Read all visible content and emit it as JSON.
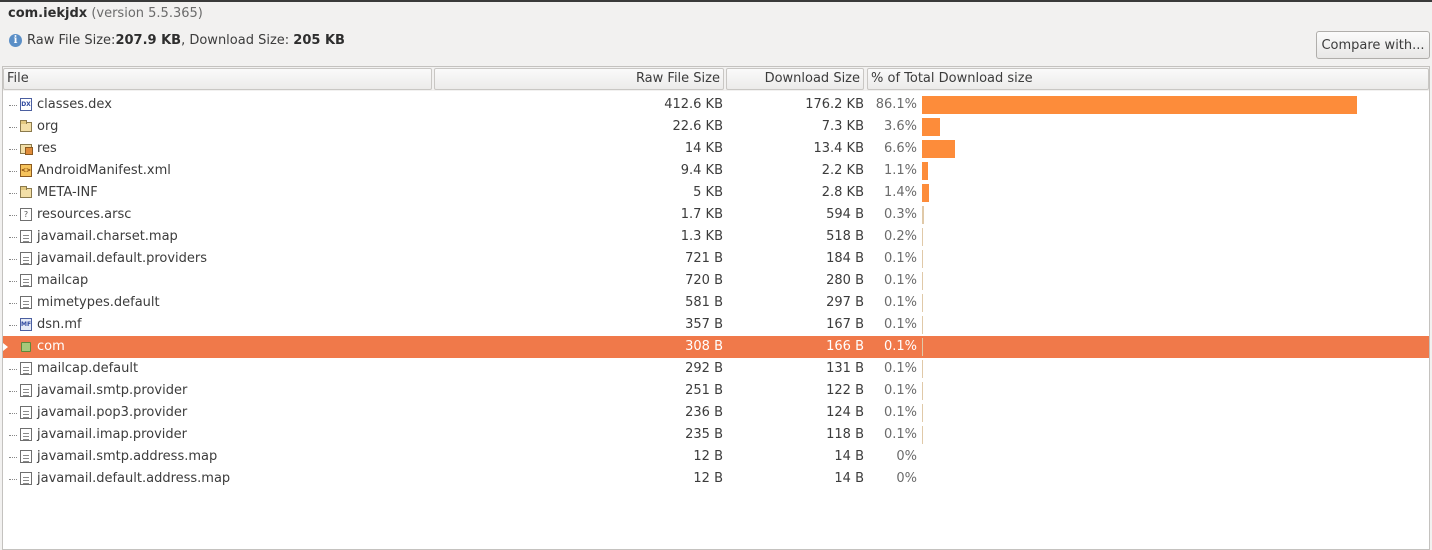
{
  "header": {
    "package": "com.iekjdx",
    "version": "(version 5.5.365)",
    "raw_label": "Raw File Size: ",
    "raw_value": "207.9 KB",
    "sep": ", Download Size: ",
    "dl_value": "205 KB",
    "compare_label": "Compare with..."
  },
  "columns": {
    "file": "File",
    "raw": "Raw File Size",
    "download": "Download Size",
    "percent": "% of Total Download size"
  },
  "rows": [
    {
      "name": "classes.dex",
      "icon": "dex-file-icon",
      "raw": "412.6 KB",
      "dl": "176.2 KB",
      "pct": "86.1%",
      "frac": 0.861
    },
    {
      "name": "org",
      "icon": "folder-icon",
      "raw": "22.6 KB",
      "dl": "7.3 KB",
      "pct": "3.6%",
      "frac": 0.036
    },
    {
      "name": "res",
      "icon": "resource-folder-icon",
      "raw": "14 KB",
      "dl": "13.4 KB",
      "pct": "6.6%",
      "frac": 0.066
    },
    {
      "name": "AndroidManifest.xml",
      "icon": "xml-file-icon",
      "raw": "9.4 KB",
      "dl": "2.2 KB",
      "pct": "1.1%",
      "frac": 0.011
    },
    {
      "name": "META-INF",
      "icon": "folder-icon",
      "raw": "5 KB",
      "dl": "2.8 KB",
      "pct": "1.4%",
      "frac": 0.014
    },
    {
      "name": "resources.arsc",
      "icon": "unknown-file-icon",
      "raw": "1.7 KB",
      "dl": "594 B",
      "pct": "0.3%",
      "frac": 0.003
    },
    {
      "name": "javamail.charset.map",
      "icon": "text-file-icon",
      "raw": "1.3 KB",
      "dl": "518 B",
      "pct": "0.2%",
      "frac": 0.002
    },
    {
      "name": "javamail.default.providers",
      "icon": "text-file-icon",
      "raw": "721 B",
      "dl": "184 B",
      "pct": "0.1%",
      "frac": 0.001
    },
    {
      "name": "mailcap",
      "icon": "text-file-icon",
      "raw": "720 B",
      "dl": "280 B",
      "pct": "0.1%",
      "frac": 0.001
    },
    {
      "name": "mimetypes.default",
      "icon": "text-file-icon",
      "raw": "581 B",
      "dl": "297 B",
      "pct": "0.1%",
      "frac": 0.001
    },
    {
      "name": "dsn.mf",
      "icon": "manifest-file-icon",
      "raw": "357 B",
      "dl": "167 B",
      "pct": "0.1%",
      "frac": 0.001
    },
    {
      "name": "com",
      "icon": "package-icon",
      "raw": "308 B",
      "dl": "166 B",
      "pct": "0.1%",
      "frac": 0.001,
      "selected": true,
      "expandable": true
    },
    {
      "name": "mailcap.default",
      "icon": "text-file-icon",
      "raw": "292 B",
      "dl": "131 B",
      "pct": "0.1%",
      "frac": 0.001
    },
    {
      "name": "javamail.smtp.provider",
      "icon": "text-file-icon",
      "raw": "251 B",
      "dl": "122 B",
      "pct": "0.1%",
      "frac": 0.001
    },
    {
      "name": "javamail.pop3.provider",
      "icon": "text-file-icon",
      "raw": "236 B",
      "dl": "124 B",
      "pct": "0.1%",
      "frac": 0.001
    },
    {
      "name": "javamail.imap.provider",
      "icon": "text-file-icon",
      "raw": "235 B",
      "dl": "118 B",
      "pct": "0.1%",
      "frac": 0.001
    },
    {
      "name": "javamail.smtp.address.map",
      "icon": "text-file-icon",
      "raw": "12 B",
      "dl": "14 B",
      "pct": "0%",
      "frac": 0
    },
    {
      "name": "javamail.default.address.map",
      "icon": "text-file-icon",
      "raw": "12 B",
      "dl": "14 B",
      "pct": "0%",
      "frac": 0
    }
  ],
  "colors": {
    "bar": "#fd8c3a",
    "selection": "#f0794a"
  }
}
